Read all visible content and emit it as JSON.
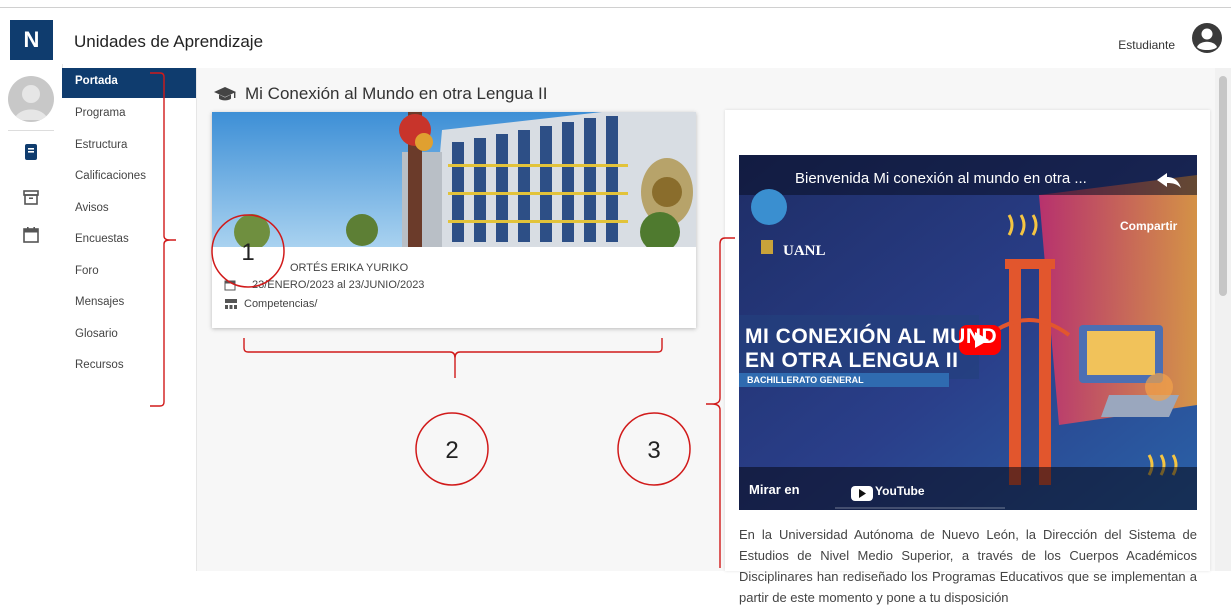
{
  "app": {
    "logo_letter": "N",
    "title": "Unidades de Aprendizaje",
    "user_role": "Estudiante"
  },
  "rail": {
    "icons": [
      "book-icon",
      "archive-icon",
      "calendar-icon"
    ]
  },
  "menu": {
    "items": [
      {
        "label": "Portada",
        "active": true
      },
      {
        "label": "Programa"
      },
      {
        "label": "Estructura"
      },
      {
        "label": "Calificaciones"
      },
      {
        "label": "Avisos"
      },
      {
        "label": "Encuestas"
      },
      {
        "label": "Foro"
      },
      {
        "label": "Mensajes"
      },
      {
        "label": "Glosario"
      },
      {
        "label": "Recursos"
      }
    ]
  },
  "course": {
    "title": "Mi Conexión al Mundo en otra Lengua II",
    "teacher": "ORTÉS ERIKA YURIKO",
    "dates": "23/ENERO/2023 al 23/JUNIO/2023",
    "competencies": "Competencias/"
  },
  "video": {
    "title": "Bienvenida Mi conexión al mundo en otra ...",
    "share": "Compartir",
    "brand": "UANL",
    "thumb_line1": "MI CONEXIÓN AL MUND",
    "thumb_line2": "EN OTRA LENGUA II",
    "thumb_sub": "BACHILLERATO GENERAL",
    "watch_on": "Mirar en",
    "youtube": "YouTube"
  },
  "intro_text": "En la Universidad Autónoma de Nuevo León, la Dirección del Sistema de Estudios de Nivel Medio Superior, a través de los Cuerpos Académicos Disciplinares han rediseñado los Programas Educativos que se implementan a partir de este momento y pone a tu disposición",
  "annotations": [
    "1",
    "2",
    "3"
  ],
  "colors": {
    "brand_blue": "#0f3c6e",
    "annotation_red": "#d11a1a",
    "youtube_red": "#ff0000"
  }
}
